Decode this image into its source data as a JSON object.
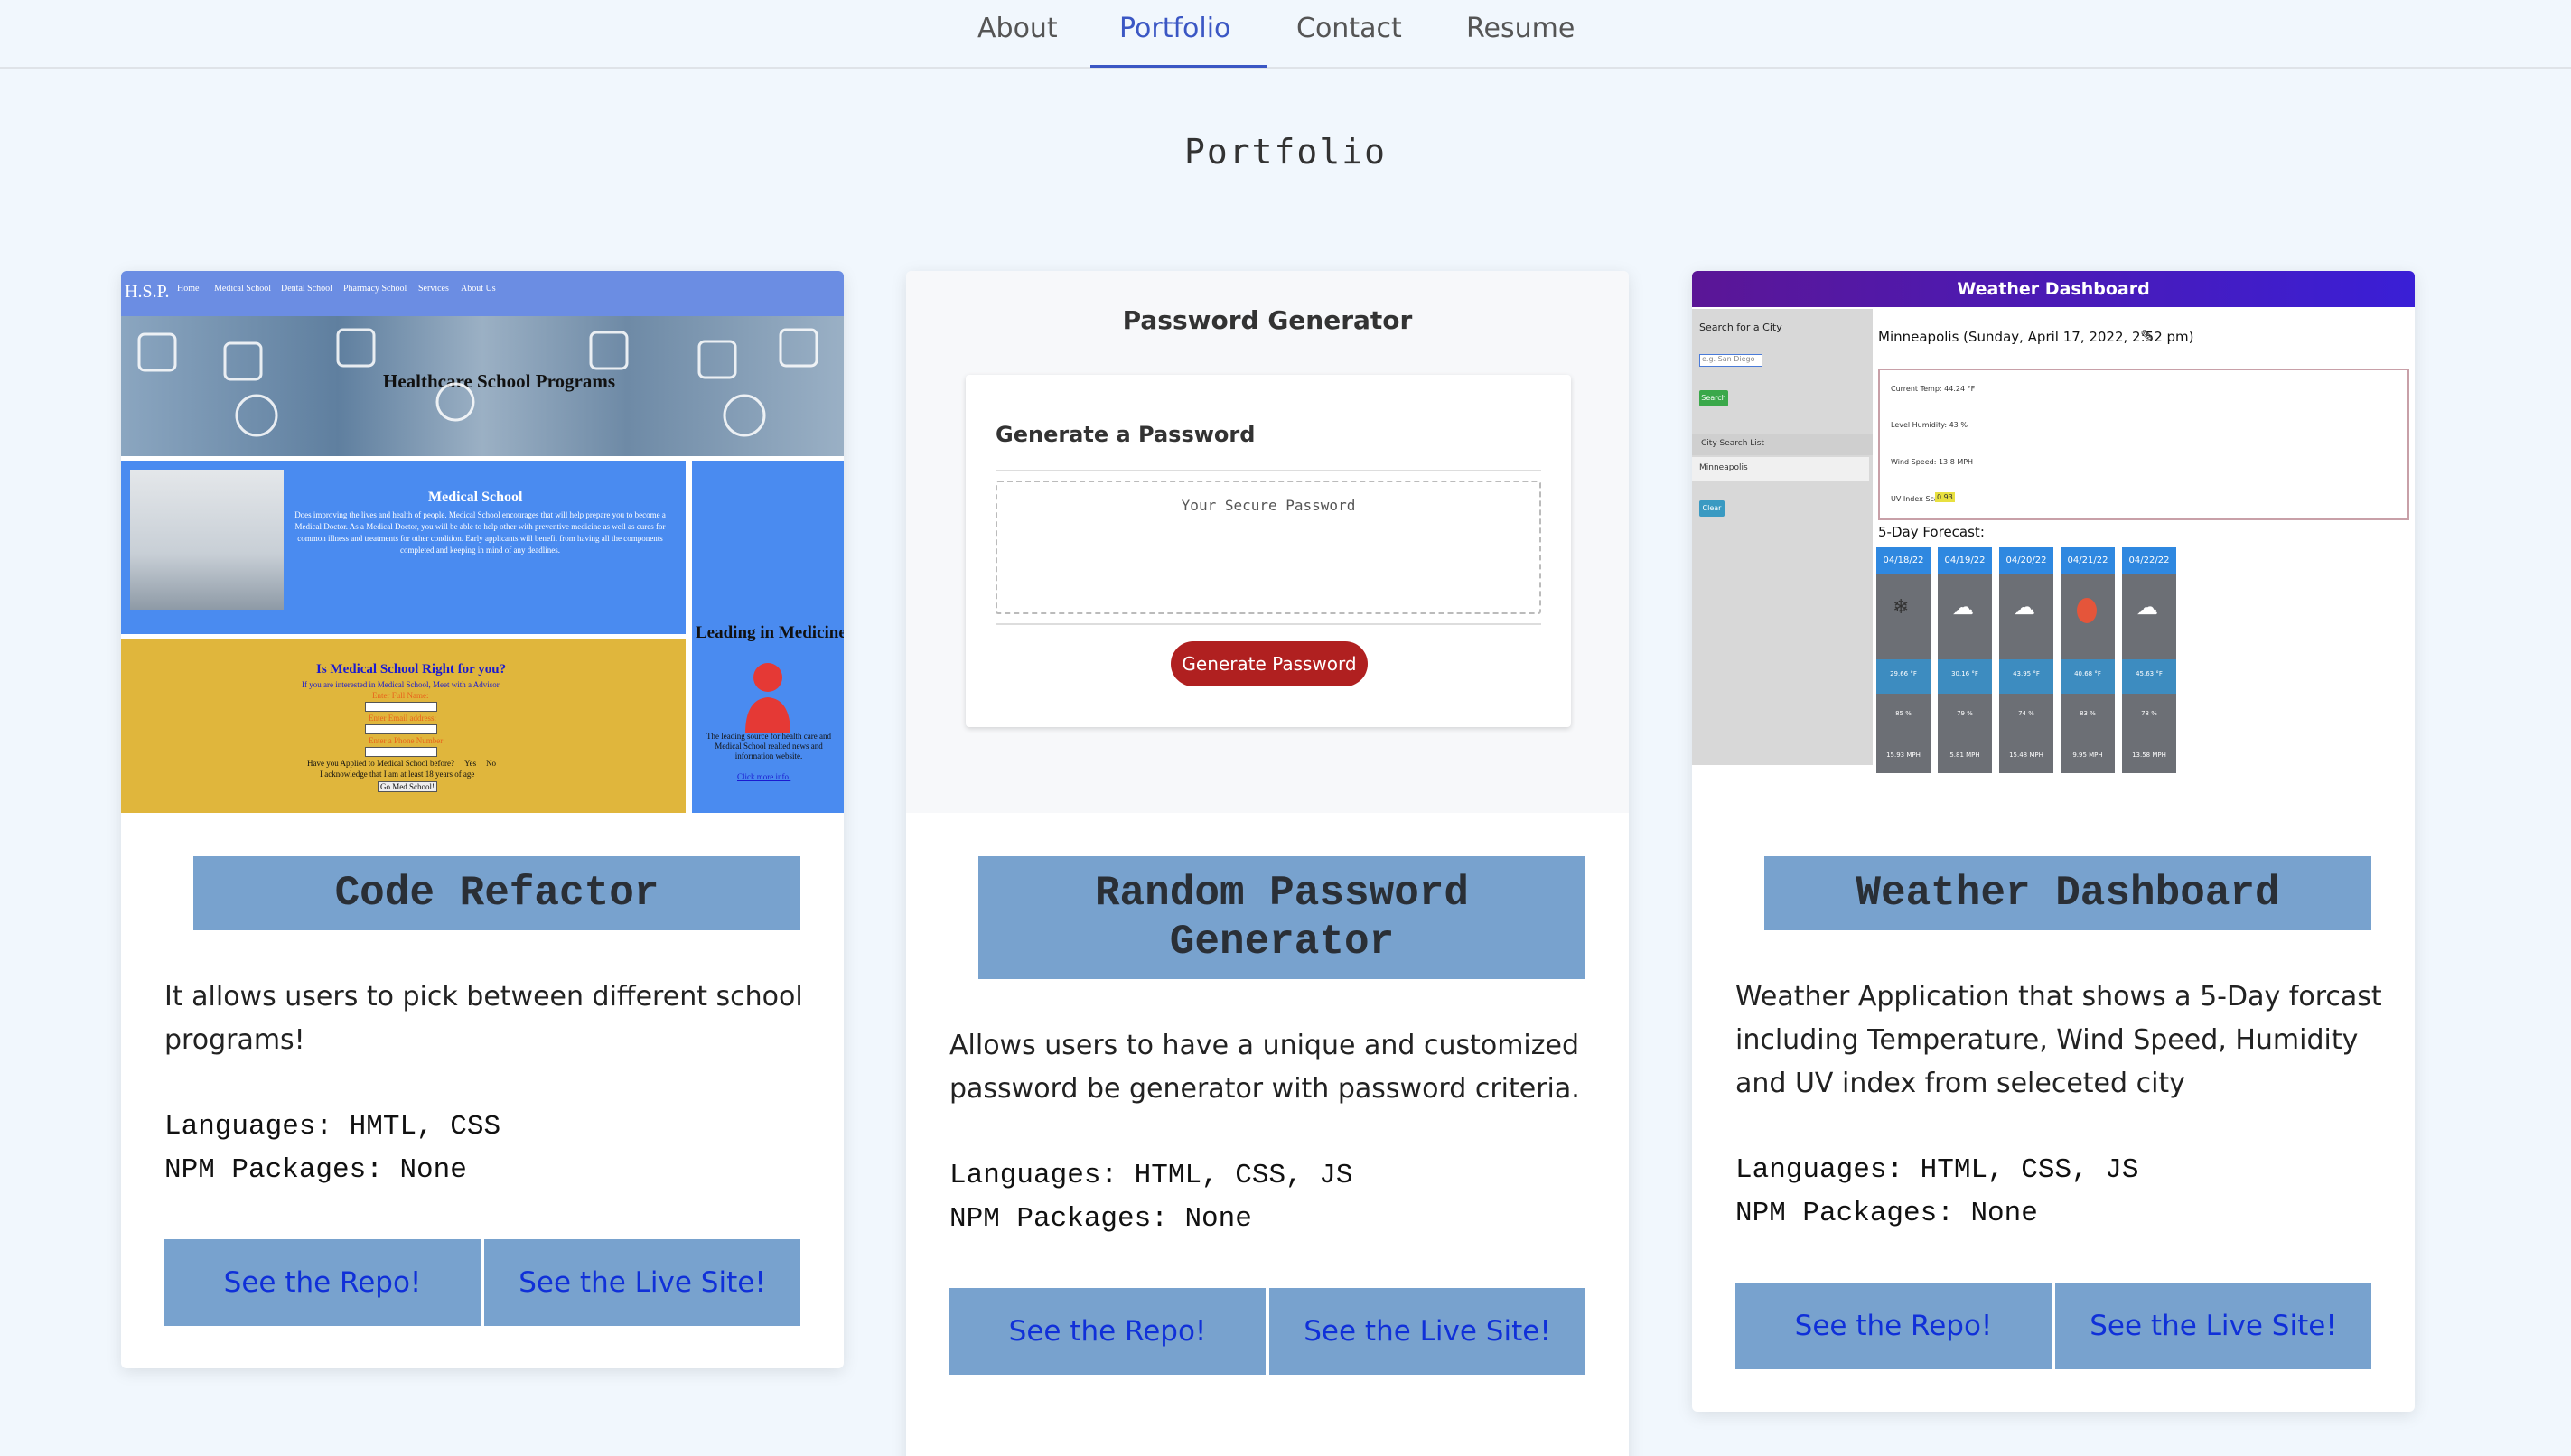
{
  "nav": {
    "items": [
      "About",
      "Portfolio",
      "Contact",
      "Resume"
    ],
    "active": "Portfolio"
  },
  "page_title": "Portfolio",
  "colors": {
    "accent": "#3b57c4",
    "title_bg": "#78a2ce",
    "button_text": "#1030d8"
  },
  "cards": [
    {
      "title": "Code Refactor",
      "description": "It allows users to pick between different school programs!",
      "languages": "Languages: HMTL, CSS",
      "packages": "NPM Packages: None",
      "repo_label": "See the Repo!",
      "live_label": "See the Live Site!",
      "preview": {
        "brand": "H.S.P.",
        "menu": [
          "Home",
          "Medical School",
          "Dental School",
          "Pharmacy School",
          "Services",
          "About Us"
        ],
        "banner": "Healthcare School Programs",
        "section_title": "Medical School",
        "section_text": "Does improving the lives and health of people. Medical School encourages that will help prepare you to become a Medical Doctor. As a Medical Doctor, you will be able to help other with preventive medicine as well as cures for common illness and treatments for other condition. Early applicants will benefit from having all the components completed and keeping in mind of any deadlines.",
        "side_title": "Leading in Medicine",
        "side_text": "The leading source for health care and Medical School realted news and information website.",
        "side_link": "Click more info.",
        "form_title": "Is Medical School Right for you?",
        "form_sub": "If you are interested in Medical School, Meet with a Advisor",
        "field_name": "Enter Full Name:",
        "field_email": "Enter Email address:",
        "field_phone": "Enter a Phone Number",
        "question": "Have you Applied to Medical School before?",
        "yes": "Yes",
        "no": "No",
        "ack": "I acknowledge that I am at least 18 years of age",
        "submit": "Go Med School!"
      }
    },
    {
      "title": "Random Password Generator",
      "description": "Allows users to have a unique and customized password be generator with password criteria.",
      "languages": "Languages: HTML, CSS, JS",
      "packages": "NPM Packages: None",
      "repo_label": "See the Repo!",
      "live_label": "See the Live Site!",
      "preview": {
        "heading": "Password Generator",
        "subheading": "Generate a Password",
        "placeholder": "Your Secure Password",
        "button": "Generate Password"
      }
    },
    {
      "title": "Weather Dashboard",
      "description": "Weather Application that shows a 5-Day forcast including Temperature, Wind Speed, Humidity and UV index from seleceted city",
      "languages": "Languages: HTML, CSS, JS",
      "packages": "NPM Packages: None",
      "repo_label": "See the Repo!",
      "live_label": "See the Live Site!",
      "preview": {
        "header": "Weather Dashboard",
        "search_label": "Search for a City",
        "search_placeholder": "e.g. San Diego",
        "search_btn": "Search",
        "list_label": "City Search List",
        "list_item": "Minneapolis",
        "clear_btn": "Clear",
        "city_line": "Minneapolis (Sunday, April 17, 2022, 2:52 pm)",
        "temp": "Current Temp: 44.24 °F",
        "humidity": "Level Humidity: 43 %",
        "wind": "Wind Speed: 13.8 MPH",
        "uv": "UV Index Scale:",
        "uv_value": "0.93",
        "forecast_label": "5-Day Forecast:",
        "days": [
          {
            "date": "04/18/22",
            "temp": "29.66 °F",
            "hum": "85 %",
            "wind": "15.93 MPH"
          },
          {
            "date": "04/19/22",
            "temp": "30.16 °F",
            "hum": "79 %",
            "wind": "5.81 MPH"
          },
          {
            "date": "04/20/22",
            "temp": "43.95 °F",
            "hum": "74 %",
            "wind": "15.48 MPH"
          },
          {
            "date": "04/21/22",
            "temp": "40.68 °F",
            "hum": "83 %",
            "wind": "9.95 MPH"
          },
          {
            "date": "04/22/22",
            "temp": "45.63 °F",
            "hum": "78 %",
            "wind": "13.58 MPH"
          }
        ]
      }
    }
  ]
}
